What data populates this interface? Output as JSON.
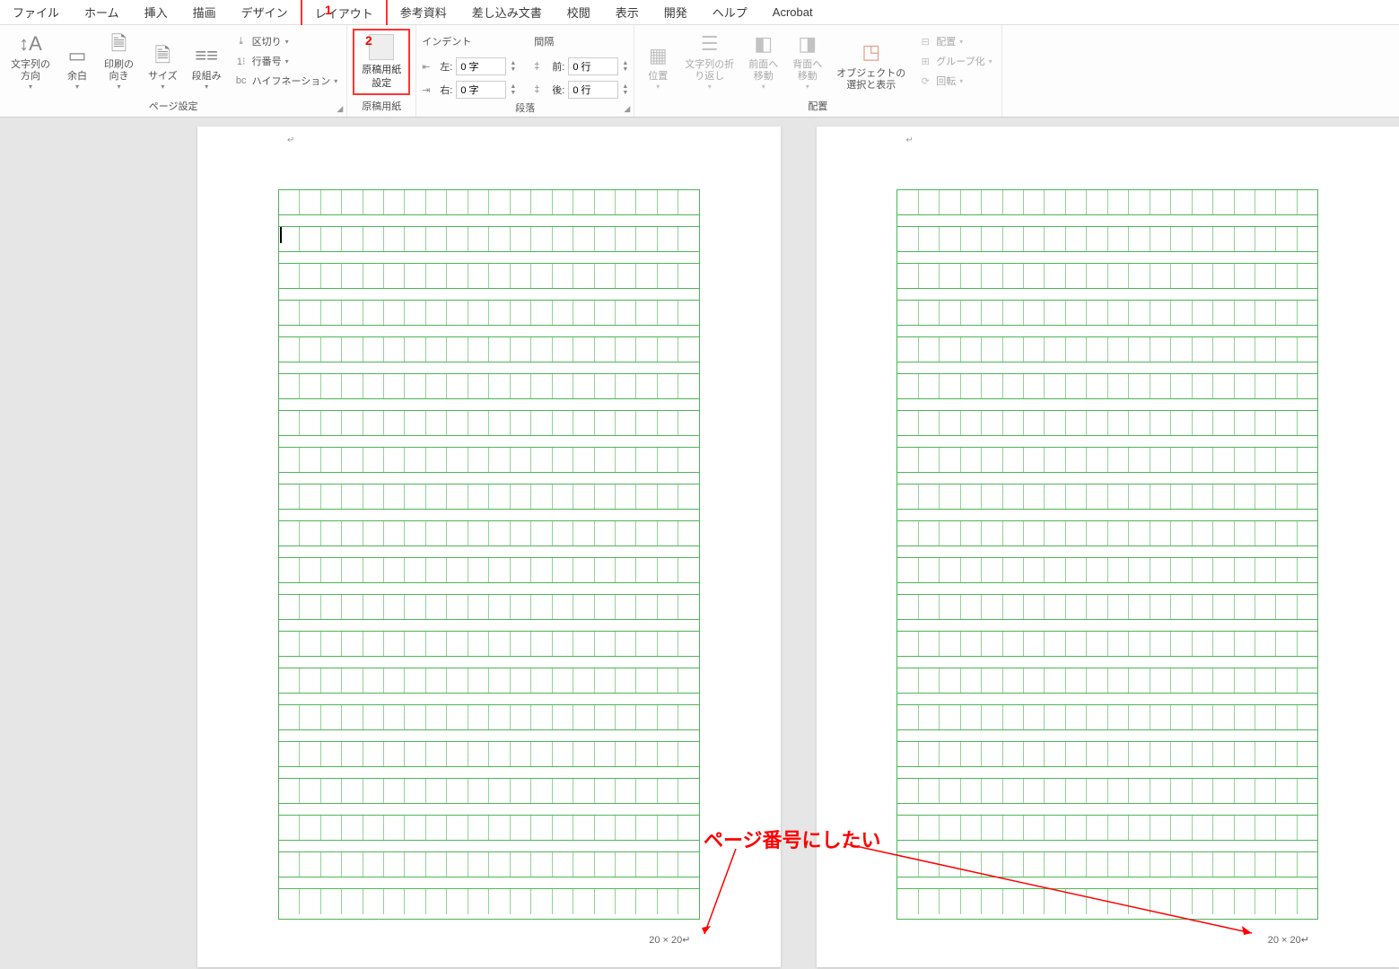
{
  "annotations": {
    "num1": "1",
    "num2": "2",
    "text": "ページ番号にしたい"
  },
  "tabs": {
    "file": "ファイル",
    "home": "ホーム",
    "insert": "挿入",
    "draw": "描画",
    "design": "デザイン",
    "layout": "レイアウト",
    "references": "参考資料",
    "mailings": "差し込み文書",
    "review": "校閲",
    "view": "表示",
    "developer": "開発",
    "help": "ヘルプ",
    "acrobat": "Acrobat"
  },
  "page_setup": {
    "group_label": "ページ設定",
    "text_direction": "文字列の\n方向",
    "margins": "余白",
    "orientation": "印刷の\n向き",
    "size": "サイズ",
    "columns": "段組み",
    "breaks": "区切り",
    "line_numbers": "行番号",
    "hyphenation": "ハイフネーション"
  },
  "genkou": {
    "group_label": "原稿用紙",
    "button": "原稿用紙\n設定"
  },
  "paragraph": {
    "group_label": "段落",
    "indent_header": "インデント",
    "spacing_header": "間隔",
    "left_label": "左:",
    "right_label": "右:",
    "before_label": "前:",
    "after_label": "後:",
    "left_val": "0 字",
    "right_val": "0 字",
    "before_val": "0 行",
    "after_val": "0 行"
  },
  "arrange": {
    "group_label": "配置",
    "position": "位置",
    "wrap": "文字列の折\nり返し",
    "bring_forward": "前面へ\n移動",
    "send_backward": "背面へ\n移動",
    "selection_pane": "オブジェクトの\n選択と表示",
    "align": "配置",
    "group": "グループ化",
    "rotate": "回転"
  },
  "page": {
    "footer": "20 × 20↵"
  }
}
